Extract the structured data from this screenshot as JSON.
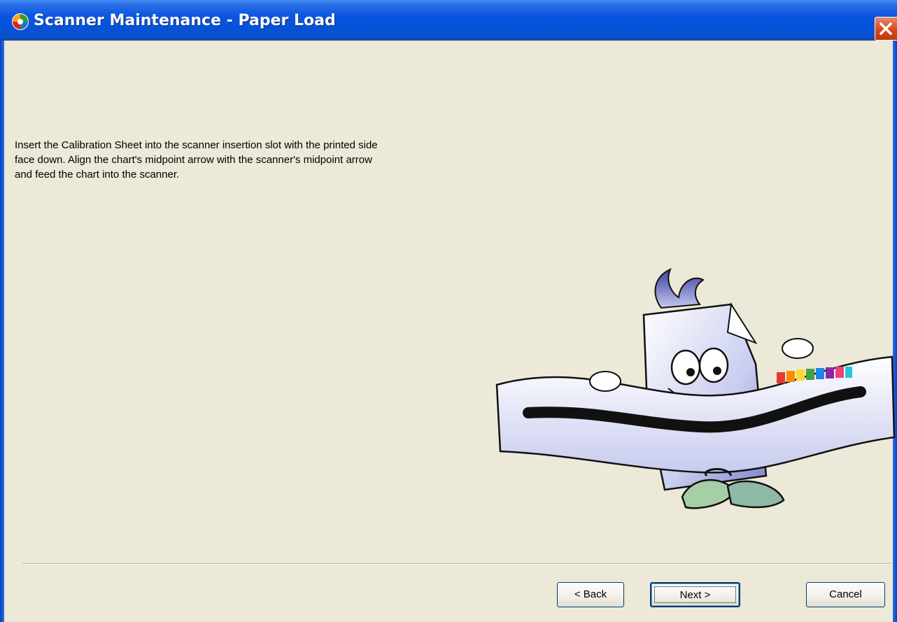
{
  "window": {
    "title": "Scanner Maintenance - Paper Load"
  },
  "content": {
    "instructions_line1": "Insert the Calibration Sheet into the scanner insertion slot with the printed side",
    "instructions_line2": "face down. Align the chart's midpoint arrow with the scanner's midpoint arrow",
    "instructions_line3": "and feed the chart into the scanner."
  },
  "buttons": {
    "back_label": "< Back",
    "next_label": "Next >",
    "cancel_label": "Cancel"
  },
  "icons": {
    "app": "scanner-app-icon",
    "close": "close-icon",
    "illustration": "paper-mascot-illustration"
  },
  "colors": {
    "titlebar": "#0a55df",
    "window_bg": "#ece9d8",
    "close_button": "#d8471c"
  }
}
